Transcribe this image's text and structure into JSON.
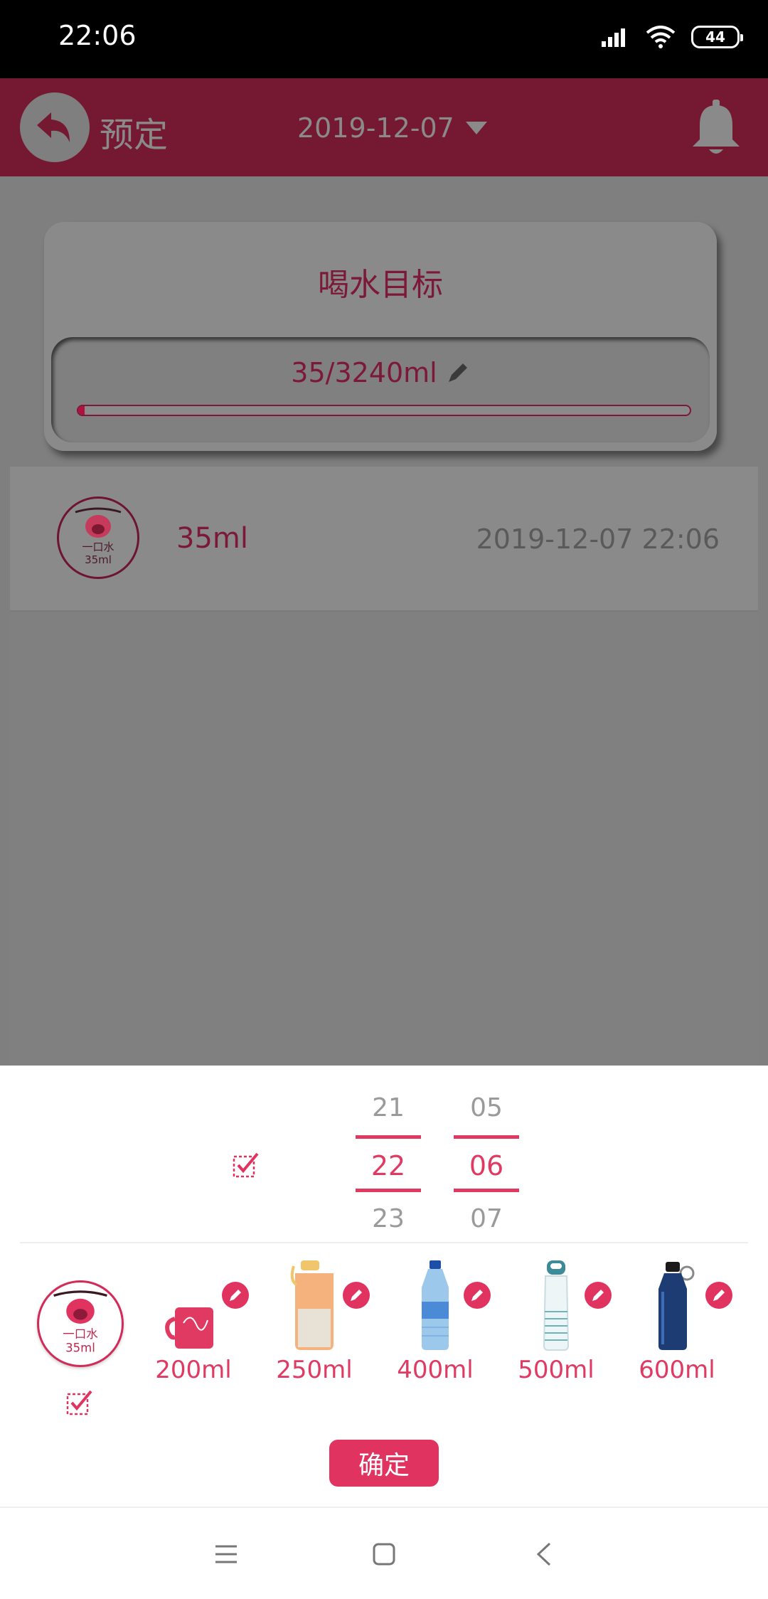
{
  "status_bar": {
    "time": "22:06",
    "battery": "44"
  },
  "header": {
    "back_label": "预定",
    "date": "2019-12-07"
  },
  "goal": {
    "title": "喝水目标",
    "amount": "35/3240ml",
    "progress_fraction": 0.0108
  },
  "records": [
    {
      "icon_top": "一口水",
      "icon_bottom": "35ml",
      "amount": "35ml",
      "time": "2019-12-07 22:06"
    }
  ],
  "picker": {
    "hours": {
      "prev": "21",
      "current": "22",
      "next": "23"
    },
    "minutes": {
      "prev": "05",
      "current": "06",
      "next": "07"
    }
  },
  "cups": {
    "main": {
      "top": "一口水",
      "bottom": "35ml"
    },
    "items": [
      {
        "label": "200ml",
        "icon": "mug-icon"
      },
      {
        "label": "250ml",
        "icon": "sports-bottle-icon"
      },
      {
        "label": "400ml",
        "icon": "water-bottle-icon"
      },
      {
        "label": "500ml",
        "icon": "glass-bottle-icon"
      },
      {
        "label": "600ml",
        "icon": "flask-icon"
      }
    ]
  },
  "confirm_label": "确定",
  "colors": {
    "accent": "#e0335f",
    "header": "#751932",
    "text_accent": "#7c1838"
  }
}
